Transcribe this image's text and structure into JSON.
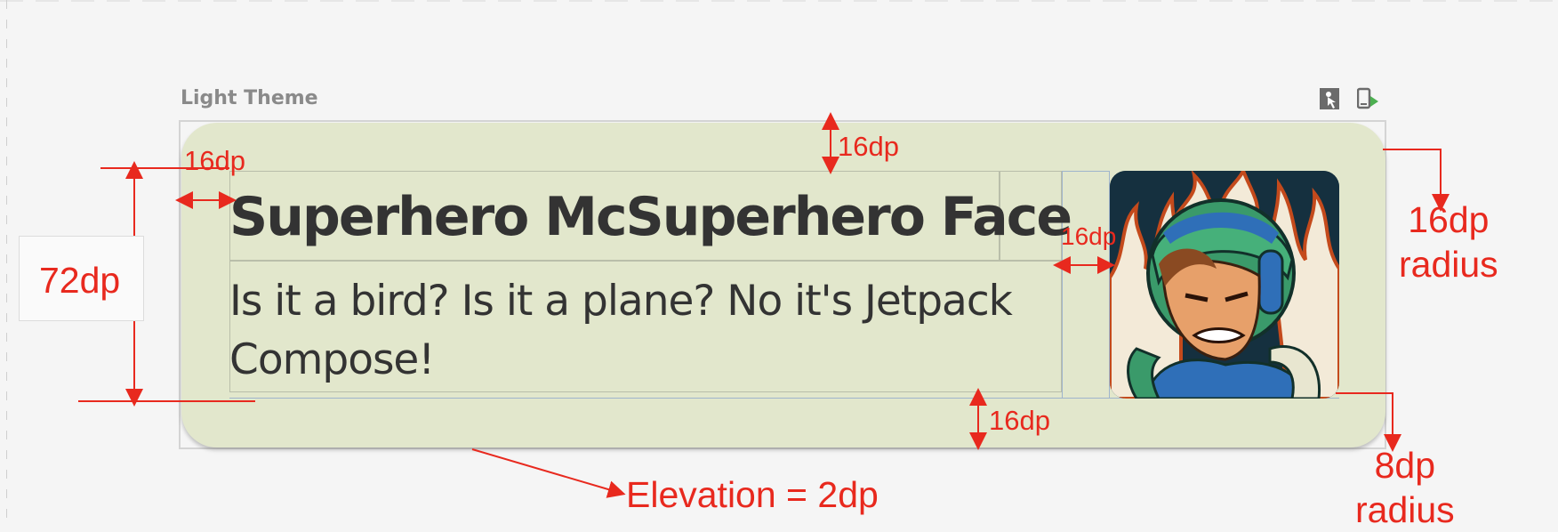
{
  "preview": {
    "label": "Light Theme",
    "icons": [
      "interactive-mode-icon",
      "deploy-preview-icon"
    ]
  },
  "card": {
    "title": "Superhero McSuperhero Face",
    "description": "Is it a bird? Is it a plane? No it's Jetpack Compose!",
    "background": "#e2e7cc",
    "image": "superhero-portrait"
  },
  "annotations": {
    "height": "72dp",
    "padding_left": "16dp",
    "padding_top": "16dp",
    "padding_image": "16dp",
    "padding_bottom": "16dp",
    "card_radius": "16dp\nradius",
    "image_radius": "8dp\nradius",
    "elevation": "Elevation = 2dp",
    "color": "#e8291e"
  }
}
